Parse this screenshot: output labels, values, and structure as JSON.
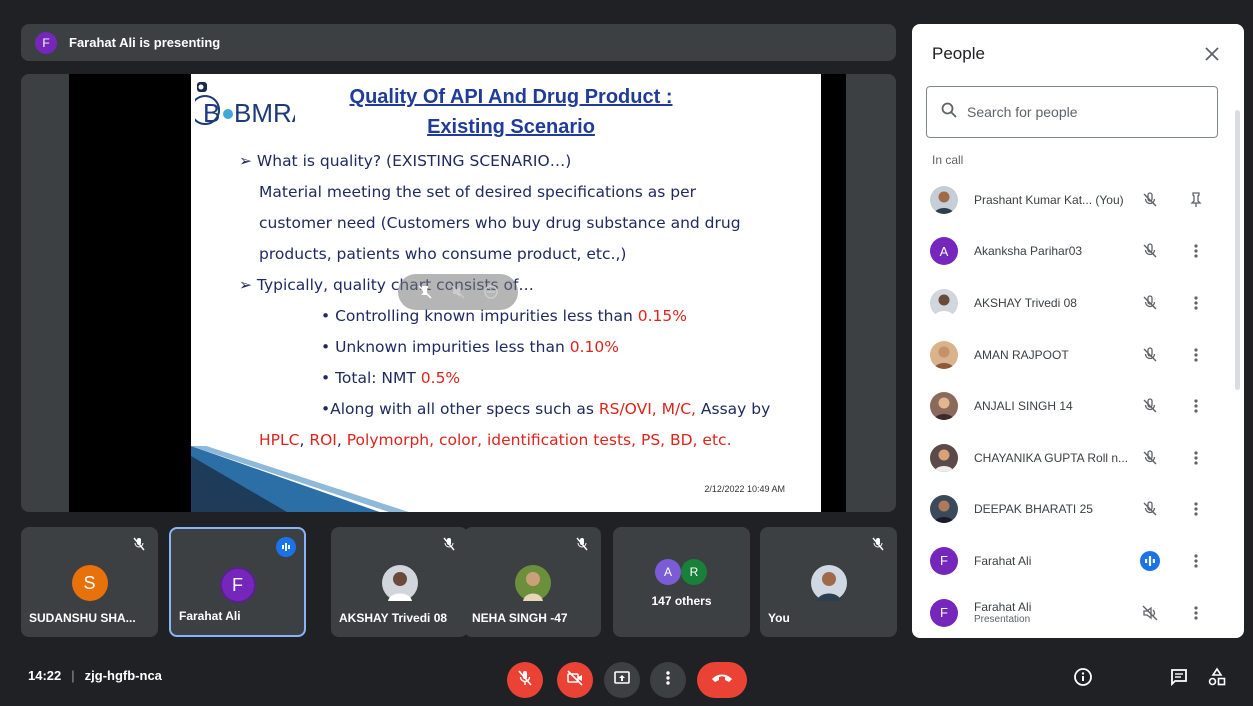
{
  "presenting": {
    "initial": "F",
    "text": "Farahat Ali is presenting"
  },
  "slide": {
    "logo": "BMRA",
    "title_line1": "Quality Of API And Drug Product :",
    "title_line2": "Existing Scenario",
    "lines": [
      "➢ What is quality? (EXISTING SCENARIO…)",
      "Material meeting the set of desired specifications as per",
      "customer need (Customers who buy drug substance and drug",
      "products, patients who consume product, etc.,)",
      "➢ Typically, quality chart consists of…"
    ],
    "bullet1_text": "• Controlling known impurities less than ",
    "bullet1_value": "0.15%",
    "bullet2_text": "• Unknown impurities less than ",
    "bullet2_value": "0.10%",
    "bullet3_text": "• Total: NMT ",
    "bullet3_value": "0.5%",
    "bullet4_text": "•Along with all other specs such as ",
    "bullet4_red": "RS/OVI, M/C,",
    "bullet4_tail": " Assay by",
    "bullet5_red1": "HPLC",
    "bullet5_sep1": ", ",
    "bullet5_red2": "ROI",
    "bullet5_sep2": ",  ",
    "bullet5_red3": "Polymorph, color, identification tests, PS, BD, etc.",
    "date": "2/12/2022 10:49 AM"
  },
  "tiles": [
    {
      "name": "SUDANSHU SHA...",
      "initial": "S",
      "color": "#e8710a"
    },
    {
      "name": "Farahat Ali",
      "initial": "F",
      "color": "#7627bb"
    },
    {
      "name": "AKSHAY Trivedi 08"
    },
    {
      "name": "NEHA SINGH -47"
    },
    {
      "others_label": "147 others",
      "a": "A",
      "r": "R"
    },
    {
      "name": "You"
    }
  ],
  "people": {
    "title": "People",
    "search_placeholder": "Search for people",
    "section": "In call",
    "rows": [
      {
        "name": "Prashant Kumar Kat...",
        "you": "(You)",
        "initial": ""
      },
      {
        "name": "Akanksha Parihar03",
        "initial": "A",
        "color": "#7627bb"
      },
      {
        "name": "AKSHAY Trivedi 08",
        "initial": ""
      },
      {
        "name": "AMAN RAJPOOT",
        "initial": ""
      },
      {
        "name": "ANJALI SINGH 14",
        "initial": ""
      },
      {
        "name": "CHAYANIKA GUPTA Roll n...",
        "initial": ""
      },
      {
        "name": "DEEPAK BHARATI 25",
        "initial": ""
      },
      {
        "name": "Farahat Ali",
        "initial": "F",
        "color": "#7627bb"
      },
      {
        "name": "Farahat Ali",
        "sub": "Presentation",
        "initial": "F",
        "color": "#7627bb"
      }
    ]
  },
  "bottom": {
    "time": "14:22",
    "meeting_code": "zjg-hgfb-nca"
  },
  "colors": {
    "accent_red": "#ea4335",
    "accent_blue": "#1a73e8",
    "dark_bg": "#202124",
    "tile_bg": "#3c4043"
  }
}
